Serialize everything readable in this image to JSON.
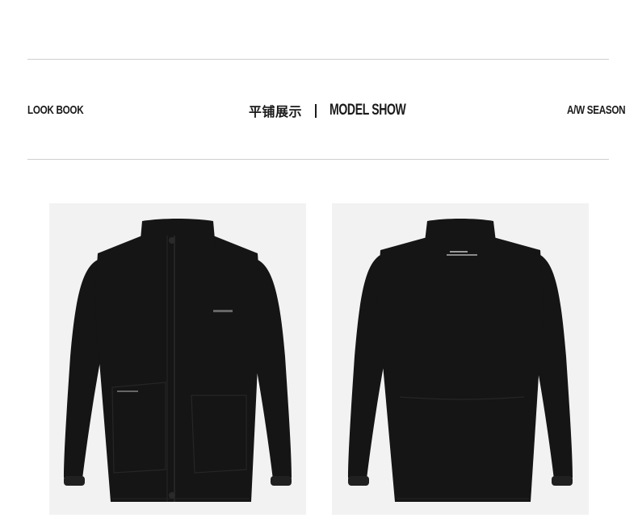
{
  "header": {
    "left_label": "LOOK BOOK",
    "center_title_cn": "平铺展示",
    "center_title_en": "MODEL SHOW",
    "right_label": "A/W SEASON"
  },
  "images": [
    {
      "name": "jacket-front-image",
      "description_icon": "jacket-front"
    },
    {
      "name": "jacket-back-image",
      "description_icon": "jacket-back"
    }
  ],
  "colors": {
    "background": "#ffffff",
    "rule": "#cfcfcf",
    "text": "#1a1a1a",
    "panel_bg": "#f2f2f3",
    "jacket": "#151515"
  }
}
